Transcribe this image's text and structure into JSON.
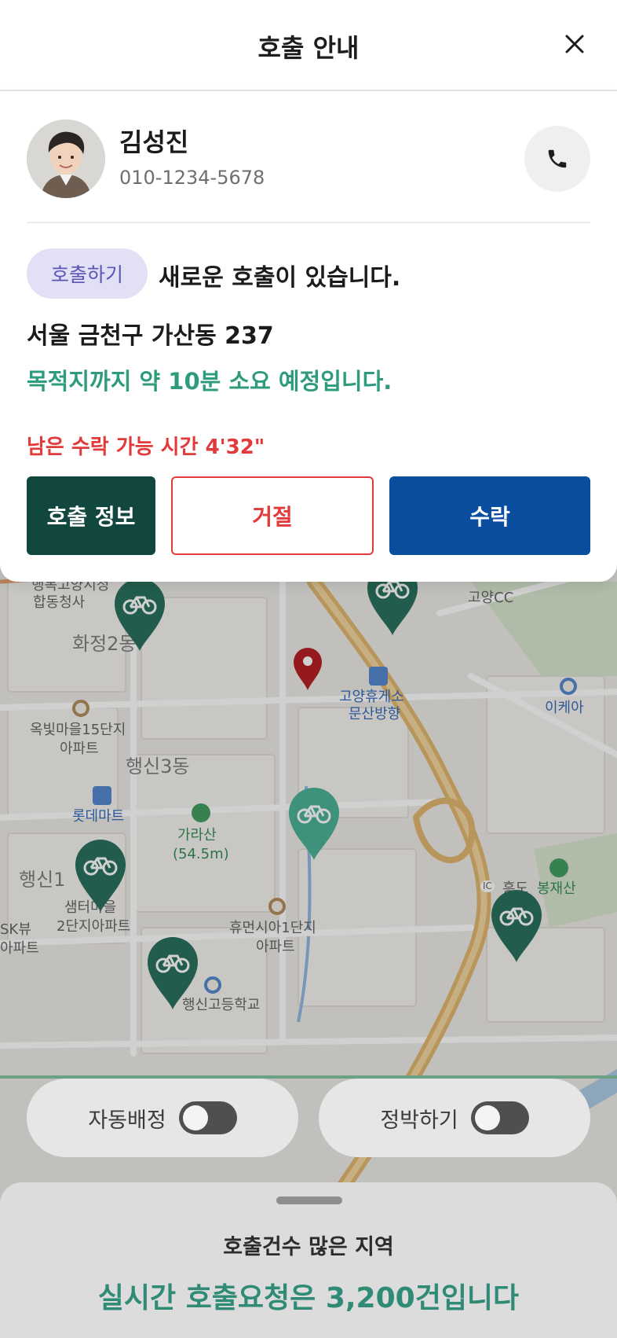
{
  "header": {
    "title": "호출 안내"
  },
  "caller": {
    "name": "김성진",
    "phone": "010-1234-5678"
  },
  "call_request": {
    "tag": "호출하기",
    "message": "새로운 호출이 있습니다.",
    "address": "서울 금천구 가산동 237",
    "eta_text": "목적지까지 약 10분 소요 예정입니다.",
    "remaining_text": "남은 수락 가능 시간 4'32\""
  },
  "actions": {
    "info_label": "호출 정보",
    "reject_label": "거절",
    "accept_label": "수락"
  },
  "toggles": {
    "auto_assign_label": "자동배정",
    "auto_assign_on": false,
    "parking_label": "정박하기",
    "parking_on": false
  },
  "bottom_sheet": {
    "title": "호출건수 많은 지역",
    "subtitle": "실시간 호출요청은 3,200건입니다"
  },
  "map": {
    "labels": {
      "l1": "행복고양시청",
      "l2": "합동청사",
      "l3": "화정2동",
      "l4": "고양CC",
      "l5": "고양휴게소",
      "l6": "문산방향",
      "l7": "이케아",
      "l8": "옥빛마을15단지",
      "l9": "아파트",
      "l10": "행신3동",
      "l11": "롯데마트",
      "l12": "가라산",
      "l13": "(54.5m)",
      "l14": "봉재산",
      "l15": "흥도",
      "l16": "행신1",
      "l17": "샘터마을",
      "l18": "2단지아파트",
      "l19": "SK뷰",
      "l20": "아파트",
      "l21": "휴먼시아1단지",
      "l22": "아파트",
      "l23": "행신고등학교",
      "l24": "IC"
    }
  },
  "colors": {
    "brand_dark": "#11473f",
    "accept_blue": "#0a4ea0",
    "reject_red": "#e23a3a",
    "eta_green": "#2e9b7c",
    "tag_bg": "#e2e0f5",
    "tag_text": "#5c56b8",
    "pin_dark_green": "#1f6b56",
    "pin_teal": "#45b092",
    "pin_red": "#b3161c"
  },
  "icons": {
    "close": "close-icon",
    "phone": "phone-icon",
    "bike_pin": "bike-pin-icon",
    "location_pin": "location-pin-icon"
  }
}
